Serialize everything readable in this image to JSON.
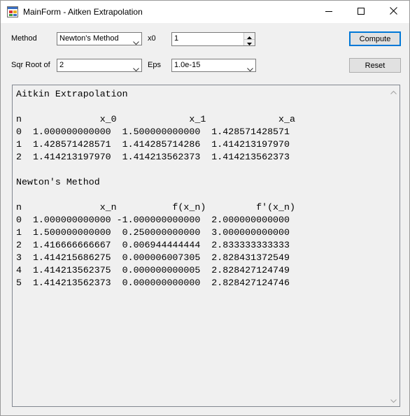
{
  "window": {
    "title": "MainForm - Aitken Extrapolation"
  },
  "controls": {
    "method_label": "Method",
    "method_value": "Newton's Method",
    "x0_label": "x0",
    "x0_value": "1",
    "sqr_label": "Sqr Root of",
    "sqr_value": "2",
    "eps_label": "Eps",
    "eps_value": "1.0e-15",
    "compute_label": "Compute",
    "reset_label": "Reset"
  },
  "output": {
    "text": "Aitkin Extrapolation\n\nn              x_0             x_1             x_a\n0  1.000000000000  1.500000000000  1.428571428571\n1  1.428571428571  1.414285714286  1.414213197970\n2  1.414213197970  1.414213562373  1.414213562373\n\nNewton's Method\n\nn              x_n          f(x_n)         f'(x_n)\n0  1.000000000000 -1.000000000000  2.000000000000\n1  1.500000000000  0.250000000000  3.000000000000\n2  1.416666666667  0.006944444444  2.833333333333\n3  1.414215686275  0.000006007305  2.828431372549\n4  1.414213562375  0.000000000005  2.828427124749\n5  1.414213562373  0.000000000000  2.828427124746"
  },
  "icons": {
    "app": "app-window-icon",
    "minimize": "minimize-icon",
    "maximize": "maximize-icon",
    "close": "close-icon"
  }
}
